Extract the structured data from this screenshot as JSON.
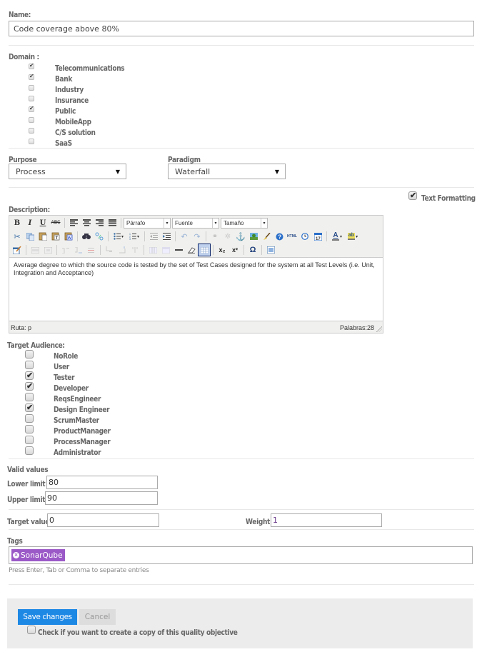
{
  "name": {
    "label": "Name:",
    "value": "Code coverage above 80%"
  },
  "domain": {
    "label": "Domain :",
    "items": [
      {
        "label": "Telecommunications",
        "checked": true
      },
      {
        "label": "Bank",
        "checked": true
      },
      {
        "label": "Industry",
        "checked": false
      },
      {
        "label": "Insurance",
        "checked": false
      },
      {
        "label": "Public",
        "checked": true
      },
      {
        "label": "MobileApp",
        "checked": false
      },
      {
        "label": "C/S solution",
        "checked": false
      },
      {
        "label": "SaaS",
        "checked": false
      }
    ]
  },
  "purpose": {
    "label": "Purpose",
    "value": "Process"
  },
  "paradigm": {
    "label": "Paradigm",
    "value": "Waterfall"
  },
  "text_formatting": {
    "label": "Text Formatting",
    "checked": true
  },
  "description": {
    "label": "Description:",
    "toolbar": {
      "format_select": "Párrafo",
      "font_select": "Fuente",
      "size_select": "Tamaño",
      "row1_icons": [
        "bold-icon",
        "italic-icon",
        "underline-icon",
        "strikethrough-icon",
        "align-left-icon",
        "align-center-icon",
        "align-right-icon",
        "align-justify-icon"
      ],
      "row2_icons": [
        "cut-icon",
        "copy-icon",
        "paste-icon",
        "paste-text-icon",
        "paste-word-icon",
        "find-icon",
        "replace-icon",
        "bullet-list-icon",
        "numbered-list-icon",
        "outdent-icon",
        "indent-icon",
        "undo-icon",
        "redo-icon",
        "link-icon",
        "unlink-icon",
        "anchor-icon",
        "image-icon",
        "cleanup-icon",
        "help-icon",
        "html-icon",
        "insert-time-icon",
        "insert-date-icon",
        "text-color-icon",
        "highlight-color-icon"
      ],
      "row3_icons": [
        "edit-css-icon",
        "table-row-props-icon",
        "table-cell-props-icon",
        "insert-row-before-icon",
        "insert-row-after-icon",
        "delete-row-icon",
        "insert-col-before-icon",
        "insert-col-after-icon",
        "delete-col-icon",
        "split-cells-icon",
        "merge-cells-icon",
        "horizontal-rule-icon",
        "remove-format-icon",
        "visual-aid-icon",
        "subscript-icon",
        "superscript-icon",
        "special-char-icon",
        "fullscreen-icon"
      ],
      "glyphs": {
        "bold": "B",
        "italic": "I",
        "underline": "U",
        "strike": "ABC",
        "html": "HTML",
        "subscript": "x₂",
        "superscript": "x²",
        "omega": "Ω",
        "text_color": "A",
        "highlight": "ab",
        "anchor": "⚓",
        "dropdown": "▾"
      }
    },
    "text": "Average degree to which the source code is tested by the set of Test Cases designed for the system at all Test Levels (i.e. Unit, Integration and Acceptance)",
    "path": "Ruta: p",
    "word_count": "Palabras:28"
  },
  "target_audience": {
    "label": "Target Audience:",
    "items": [
      {
        "label": "NoRole",
        "checked": false
      },
      {
        "label": "User",
        "checked": false
      },
      {
        "label": "Tester",
        "checked": true
      },
      {
        "label": "Developer",
        "checked": true
      },
      {
        "label": "ReqsEngineer",
        "checked": false
      },
      {
        "label": "Design Engineer",
        "checked": true
      },
      {
        "label": "ScrumMaster",
        "checked": false
      },
      {
        "label": "ProductManager",
        "checked": false
      },
      {
        "label": "ProcessManager",
        "checked": false
      },
      {
        "label": "Administrator",
        "checked": false
      }
    ]
  },
  "valid_values": {
    "label": "Valid values",
    "lower_label": "Lower limit :",
    "lower_value": "80",
    "upper_label": "Upper limit :",
    "upper_value": "90"
  },
  "target_value": {
    "label": "Target value:",
    "value": "0"
  },
  "weight": {
    "label": "Weight:",
    "value": "1"
  },
  "tags": {
    "label": "Tags",
    "items": [
      "SonarQube"
    ],
    "hint": "Press Enter, Tab or Comma to separate entries",
    "tag_color": "#9b59c7"
  },
  "footer": {
    "save_label": "Save changes",
    "cancel_label": "Cancel",
    "copy_label": "Check if you want to create a copy of this quality objective",
    "copy_checked": false,
    "save_color": "#1e88e5"
  },
  "check_glyph": "✔",
  "arrow_glyph": "▼",
  "chk_tag_x": "×"
}
